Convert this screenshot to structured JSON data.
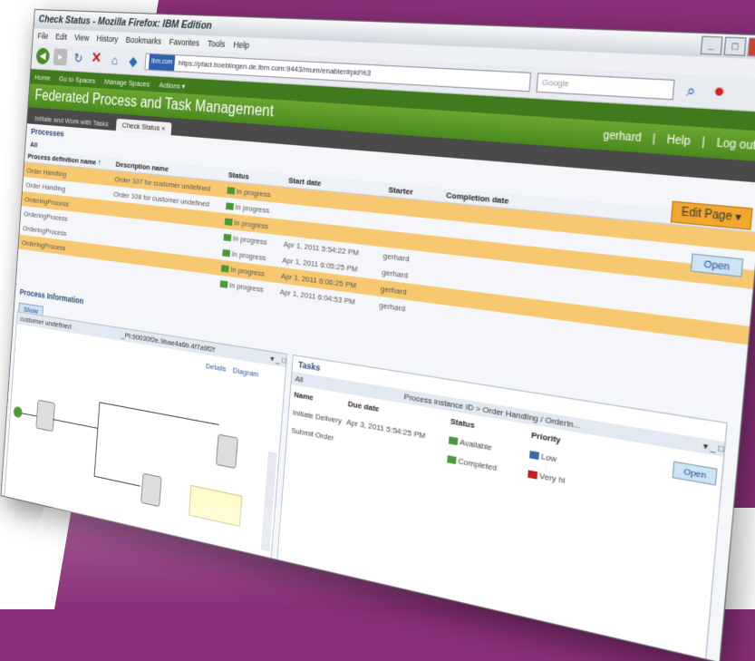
{
  "window": {
    "title": "Check Status - Mozilla Firefox: IBM Edition"
  },
  "menu": [
    "File",
    "Edit",
    "View",
    "History",
    "Bookmarks",
    "Favorites",
    "Tools",
    "Help"
  ],
  "navbar": {
    "url": "https://pfact.boeblingen.de.ibm.com:9443/mum/enabler#pid%3",
    "url_badge": "ibm.com",
    "search_placeholder": "Google"
  },
  "top_tabs": [
    "Home",
    "Go to Spaces",
    "Manage Spaces",
    "Actions ▾"
  ],
  "banner": {
    "title": "Federated Process and Task Management",
    "user": "gerhard",
    "help": "Help",
    "logout": "Log out"
  },
  "page_tabs": [
    {
      "label": "Initiate and Work with Tasks"
    },
    {
      "label": "Check Status ×"
    }
  ],
  "processes": {
    "section": "Processes",
    "filter": "All",
    "edit_page": "Edit Page ▾",
    "open_label": "Open",
    "columns": [
      "Process definition name ↑",
      "Description name",
      "Status",
      "Start date",
      "Starter",
      "Completion date"
    ],
    "rows": [
      {
        "name": "Order Handling",
        "desc": "Order 107 for customer undefined",
        "status": "In progress",
        "start": "",
        "starter": "",
        "completion": ""
      },
      {
        "name": "Order Handling",
        "desc": "Order 108 for customer undefined",
        "status": "In progress",
        "start": "",
        "starter": "",
        "completion": ""
      },
      {
        "name": "OrderingProcess",
        "desc": "",
        "status": "In progress",
        "start": "",
        "starter": "",
        "completion": ""
      },
      {
        "name": "OrderingProcess",
        "desc": "",
        "status": "In progress",
        "start": "Apr 1, 2011 5:54:22 PM",
        "starter": "gerhard",
        "completion": ""
      },
      {
        "name": "OrderingProcess",
        "desc": "",
        "status": "In progress",
        "start": "Apr 1, 2011 6:05:25 PM",
        "starter": "gerhard",
        "completion": ""
      },
      {
        "name": "OrderingProcess",
        "desc": "",
        "status": "In progress",
        "start": "Apr 1, 2011 6:06:25 PM",
        "starter": "gerhard",
        "completion": ""
      },
      {
        "name": "",
        "desc": "",
        "status": "In progress",
        "start": "Apr 1, 2011 6:04:53 PM",
        "starter": "gerhard",
        "completion": ""
      }
    ]
  },
  "process_info": {
    "section": "Process Information",
    "show_label": "Show",
    "diagram_tab": "customer undefined",
    "diagram_id": "_PI:90030f2e.9bae4a6b.4f7a9f2f",
    "details_link": "Details",
    "diagram_link": "Diagram"
  },
  "tasks": {
    "section": "Tasks",
    "filter": "All",
    "crumb": "Process instance ID > Order Handling / Orderin...",
    "open_label": "Open",
    "columns": [
      "Name",
      "Due date",
      "Status",
      "Priority"
    ],
    "rows": [
      {
        "name": "Initiate Delivery",
        "due": "Apr 3, 2011 5:54:25 PM",
        "status": "Available",
        "priority": "Low"
      },
      {
        "name": "Submit Order",
        "due": "",
        "status": "Completed",
        "priority": "Very hi"
      }
    ]
  }
}
